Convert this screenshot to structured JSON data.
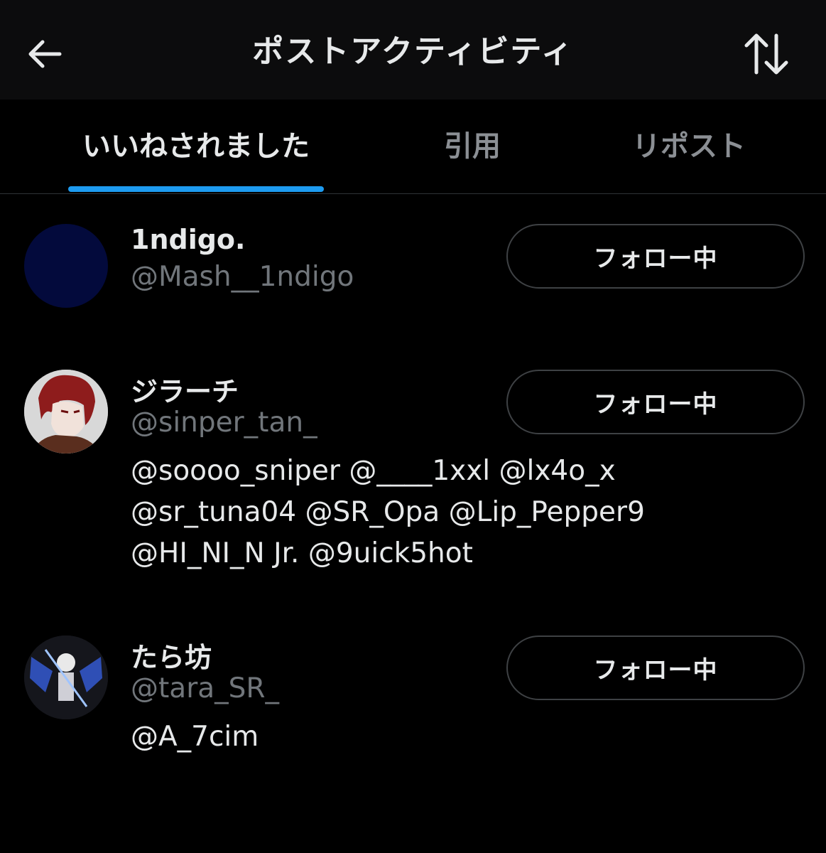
{
  "header": {
    "title": "ポストアクティビティ",
    "back_icon": "back-arrow-icon",
    "sort_icon": "sort-arrows-icon"
  },
  "tabs": [
    {
      "label": "いいねされました",
      "active": true
    },
    {
      "label": "引用",
      "active": false
    },
    {
      "label": "リポスト",
      "active": false
    }
  ],
  "colors": {
    "background": "#000000",
    "header_background": "#0c0c0d",
    "accent": "#1d9bf0",
    "text_primary": "#e7e9ea",
    "text_secondary": "#71767b",
    "divider": "#2f3336"
  },
  "users": [
    {
      "display_name": "1ndigo.",
      "handle": "@Mash__1ndigo",
      "bio_lines": [],
      "follow_label": "フォロー中"
    },
    {
      "display_name": "ジラーチ",
      "handle": "@sinper_tan_",
      "bio_lines": [
        "@soooo_sniper @____1xxl @lx4o_x",
        "@sr_tuna04 @SR_Opa @Lip_Pepper9",
        "@HI_NI_N Jr. @9uick5hot"
      ],
      "follow_label": "フォロー中"
    },
    {
      "display_name": "たら坊",
      "handle": "@tara_SR_",
      "bio_lines": [
        "@A_7cim"
      ],
      "follow_label": "フォロー中"
    }
  ]
}
